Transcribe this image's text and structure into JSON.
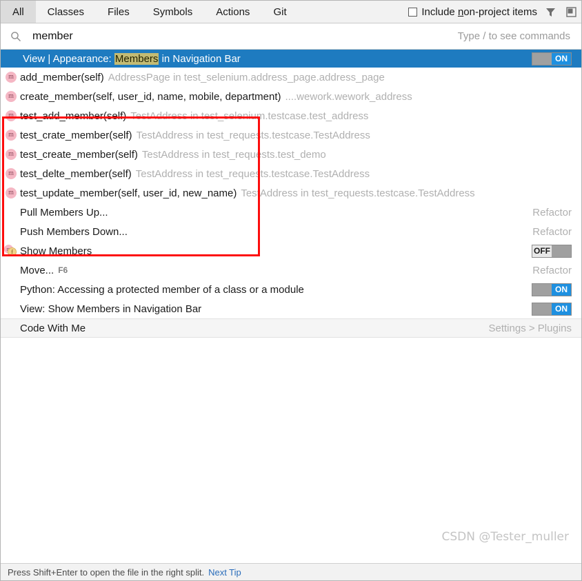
{
  "window": {
    "title": "Search Everywhere"
  },
  "tabs": [
    {
      "label": "All",
      "selected": true
    },
    {
      "label": "Classes",
      "selected": false
    },
    {
      "label": "Files",
      "selected": false
    },
    {
      "label": "Symbols",
      "selected": false
    },
    {
      "label": "Actions",
      "selected": false
    },
    {
      "label": "Git",
      "selected": false
    }
  ],
  "header": {
    "include_non_project_prefix": "Include ",
    "include_non_project_underlined": "n",
    "include_non_project_suffix": "on-project items",
    "include_non_project_checked": false,
    "filter_icon": "filter-icon",
    "preview_icon": "preview-panel-icon"
  },
  "search": {
    "icon": "search-icon",
    "value": "member",
    "placeholder": "Type / to see commands",
    "hint": "Type / to see commands"
  },
  "selected_result": {
    "prefix": "View | Appearance: ",
    "highlight": "Members",
    "suffix": " in Navigation Bar",
    "toggle_state": "ON"
  },
  "results": [
    {
      "icon": "method-icon",
      "main": "add_member(self)",
      "sub": "AddressPage in test_selenium.address_page.address_page",
      "right": ""
    },
    {
      "icon": "method-icon",
      "main": "create_member(self, user_id, name, mobile, department)",
      "sub": "....wework.wework_address",
      "right": ""
    },
    {
      "icon": "method-icon",
      "main": "test_add_member(self)",
      "sub": "TestAddress in test_selenium.testcase.test_address",
      "right": ""
    },
    {
      "icon": "method-icon",
      "main": "test_crate_member(self)",
      "sub": "TestAddress in test_requests.testcase.TestAddress",
      "right": ""
    },
    {
      "icon": "method-icon",
      "main": "test_create_member(self)",
      "sub": "TestAddress in test_requests.test_demo",
      "right": ""
    },
    {
      "icon": "method-icon",
      "main": "test_delte_member(self)",
      "sub": "TestAddress in test_requests.testcase.TestAddress",
      "right": ""
    },
    {
      "icon": "method-icon",
      "main": "test_update_member(self, user_id, new_name)",
      "sub": "TestAddress in test_requests.testcase.TestAddress",
      "right": ""
    }
  ],
  "actions": [
    {
      "icon": "",
      "main": "Pull Members Up...",
      "shortcut": "",
      "right": "Refactor",
      "toggle": ""
    },
    {
      "icon": "",
      "main": "Push Members Down...",
      "shortcut": "",
      "right": "Refactor",
      "toggle": ""
    },
    {
      "icon": "members-icon",
      "main": "Show Members",
      "shortcut": "",
      "right": "",
      "toggle": "OFF"
    },
    {
      "icon": "",
      "main": "Move...",
      "shortcut": "F6",
      "right": "Refactor",
      "toggle": ""
    },
    {
      "icon": "",
      "main": "Python: Accessing a protected member of a class or a module",
      "shortcut": "",
      "right": "",
      "toggle": "ON"
    },
    {
      "icon": "",
      "main": "View: Show Members in Navigation Bar",
      "shortcut": "",
      "right": "",
      "toggle": "ON"
    }
  ],
  "footer_item": {
    "main": "Code With Me",
    "right": "Settings > Plugins"
  },
  "watermark": "CSDN @Tester_muller",
  "statusbar": {
    "text": "Press Shift+Enter to open the file in the right split.",
    "link": "Next Tip"
  },
  "colors": {
    "selection_blue": "#1e7bc0",
    "toggle_on_blue": "#1e90e0",
    "annotation_red": "#fd0d0d",
    "highlight_olive": "#c3bb74",
    "muted_gray": "#b0b0b0"
  }
}
